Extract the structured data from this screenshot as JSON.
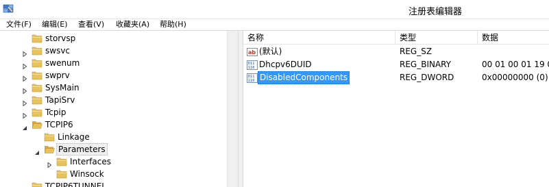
{
  "window": {
    "title": "注册表编辑器",
    "icon": "regedit-icon"
  },
  "menu": {
    "file": "文件(F)",
    "edit": "编辑(E)",
    "view": "查看(V)",
    "favorites": "收藏夹(A)",
    "help": "帮助(H)"
  },
  "tree": {
    "items": [
      {
        "label": "storvsp",
        "expander": "none"
      },
      {
        "label": "swsvc",
        "expander": "collapsed"
      },
      {
        "label": "swenum",
        "expander": "collapsed"
      },
      {
        "label": "swprv",
        "expander": "collapsed"
      },
      {
        "label": "SysMain",
        "expander": "collapsed"
      },
      {
        "label": "TapiSrv",
        "expander": "collapsed"
      },
      {
        "label": "Tcpip",
        "expander": "collapsed"
      },
      {
        "label": "TCPIP6",
        "expander": "expanded"
      },
      {
        "label": "Linkage",
        "expander": "none"
      },
      {
        "label": "Parameters",
        "expander": "expanded",
        "selected": true
      },
      {
        "label": "Interfaces",
        "expander": "collapsed"
      },
      {
        "label": "Winsock",
        "expander": "none"
      },
      {
        "label": "TCPIP6TUNNEL",
        "expander": "none"
      }
    ]
  },
  "list": {
    "headers": {
      "name": "名称",
      "type": "类型",
      "data": "数据"
    },
    "rows": [
      {
        "icon": "string-value-icon",
        "name": "(默认)",
        "type": "REG_SZ",
        "data": ""
      },
      {
        "icon": "binary-value-icon",
        "name": "Dhcpv6DUID",
        "type": "REG_BINARY",
        "data": "00 01 00 01 19 0"
      },
      {
        "icon": "dword-value-icon",
        "name": "DisabledComponents",
        "type": "REG_DWORD",
        "data": "0x00000000 (0)",
        "selected": true
      }
    ]
  },
  "colors": {
    "selection": "#3399ff",
    "folder": "#e8c25a"
  }
}
